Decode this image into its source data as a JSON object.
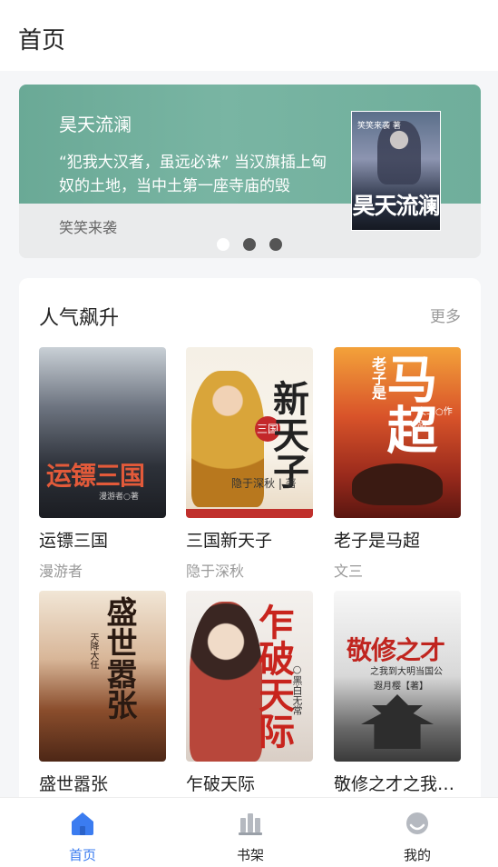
{
  "header": {
    "title": "首页"
  },
  "banner": {
    "title": "昊天流澜",
    "description": "“犯我大汉者，虽远必诛” 当汉旗插上匈奴的土地，当中土第一座寺庙的毁",
    "author": "笑笑来袭",
    "cover_text": "昊天流澜",
    "cover_tag": "笑笑来袭 著",
    "dots": 3,
    "active_dot": 0
  },
  "section": {
    "title": "人气飙升",
    "more": "更多"
  },
  "books": [
    {
      "name": "运镖三国",
      "author": "漫游者",
      "cover_title": "运镖三国",
      "cover_small": "漫游者○著"
    },
    {
      "name": "三国新天子",
      "author": "隐于深秋",
      "cover_title": "新天子",
      "cover_seal": "三国",
      "cover_small": "隐于深秋 | 著"
    },
    {
      "name": "老子是马超",
      "author": "文三",
      "cover_title": "马超",
      "cover_pre": "老子是",
      "cover_small": "文三○作品"
    },
    {
      "name": "盛世嚣张",
      "author": "",
      "cover_title": "盛世嚣张",
      "cover_small": "天降大任"
    },
    {
      "name": "乍破天际",
      "author": "",
      "cover_title": "乍破天际",
      "cover_small": "○黑白无常"
    },
    {
      "name": "敬修之才之我…",
      "author": "",
      "cover_title": "敬修之才",
      "cover_small": "之我到大明当国公",
      "cover_author": "遐月樱【著】"
    }
  ],
  "tabs": [
    {
      "label": "首页",
      "icon": "home-icon",
      "active": true
    },
    {
      "label": "书架",
      "icon": "bookshelf-icon",
      "active": false
    },
    {
      "label": "我的",
      "icon": "profile-icon",
      "active": false
    }
  ],
  "colors": {
    "accent": "#3b7cf0",
    "banner_green": "#6aa996"
  }
}
